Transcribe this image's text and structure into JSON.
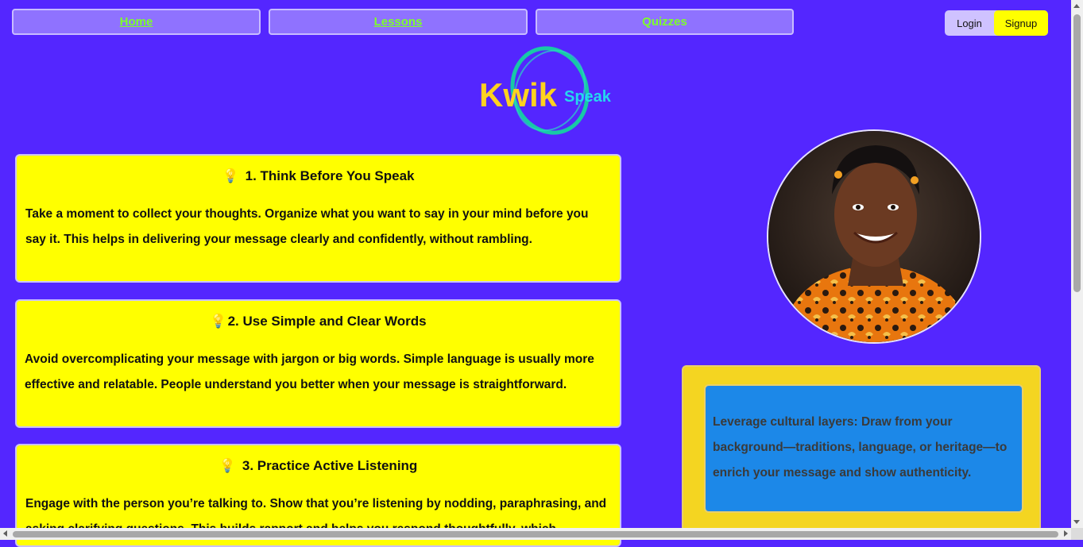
{
  "nav": {
    "home": "Home",
    "lessons": "Lessons",
    "quizzes": "Quizzes"
  },
  "auth": {
    "login": "Login",
    "signup": "Signup"
  },
  "logo": {
    "kwik": "Kwik",
    "speak": "Speak"
  },
  "tips": [
    {
      "icon": "lightbulb-icon",
      "title": "1. Think Before You Speak",
      "body": "Take a moment to collect your thoughts. Organize what you want to say in your mind before you say it. This helps in delivering your message clearly and confidently, without rambling."
    },
    {
      "icon": "lightbulb-icon",
      "title": "2. Use Simple and Clear Words",
      "body": "Avoid overcomplicating your message with jargon or big words. Simple language is usually more effective and relatable. People understand you better when your message is straightforward."
    },
    {
      "icon": "lightbulb-icon",
      "title": "3. Practice Active Listening",
      "body": "Engage with the person you’re talking to. Show that you’re listening by nodding, paraphrasing, and asking clarifying questions. This builds rapport and helps you respond thoughtfully, which"
    }
  ],
  "side_tip": "Leverage cultural layers: Draw from your background—traditions, language, or heritage—to enrich your message and show authenticity.",
  "colors": {
    "background": "#5426ff",
    "nav_text": "#7dff2a",
    "card": "#ffff00",
    "tip_outer": "#f4d521",
    "tip_inner": "#1c88e8"
  }
}
